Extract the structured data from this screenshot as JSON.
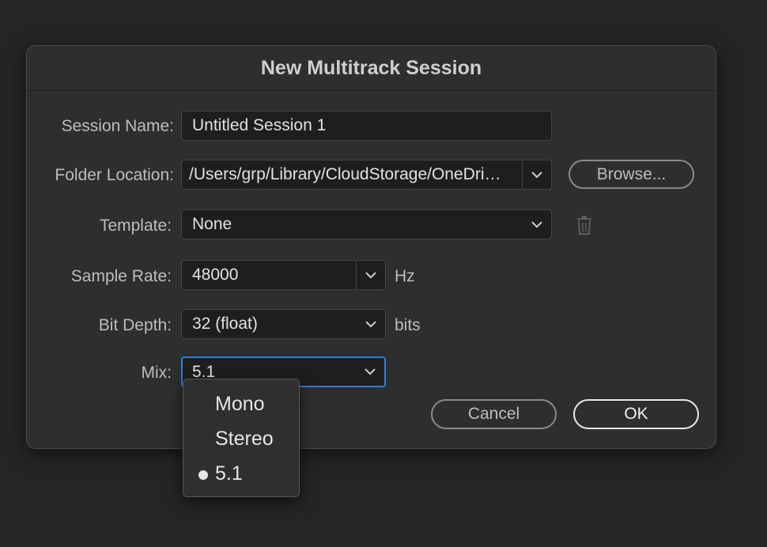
{
  "dialog": {
    "title": "New Multitrack Session",
    "session_name": {
      "label": "Session Name:",
      "value": "Untitled Session 1"
    },
    "folder_location": {
      "label": "Folder Location:",
      "value": "/Users/grp/Library/CloudStorage/OneDri…",
      "browse_label": "Browse..."
    },
    "template": {
      "label": "Template:",
      "value": "None",
      "delete_icon": "trash-icon"
    },
    "sample_rate": {
      "label": "Sample Rate:",
      "value": "48000",
      "unit": "Hz"
    },
    "bit_depth": {
      "label": "Bit Depth:",
      "value": "32 (float)",
      "unit": "bits"
    },
    "mix": {
      "label": "Mix:",
      "value": "5.1"
    },
    "cancel_label": "Cancel",
    "ok_label": "OK"
  },
  "mix_menu": {
    "options": [
      "Mono",
      "Stereo",
      "5.1"
    ],
    "selected": "5.1"
  },
  "colors": {
    "background": "#252525",
    "dialog": "#2e2e2e",
    "focus_border": "#2f7fd8"
  }
}
